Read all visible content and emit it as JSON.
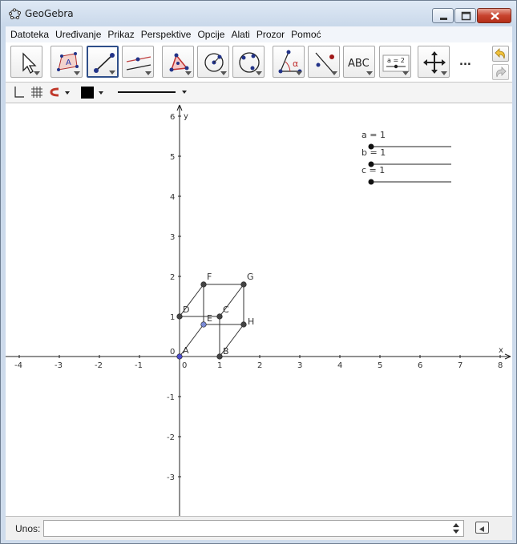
{
  "window": {
    "title": "GeoGebra"
  },
  "menubar": {
    "items": [
      "Datoteka",
      "Uređivanje",
      "Prikaz",
      "Perspektive",
      "Opcije",
      "Alati",
      "Prozor",
      "Pomoć"
    ]
  },
  "toolbar": {
    "tools": [
      "move-tool",
      "polygon-tool",
      "segment-tool",
      "parallel-line-tool",
      "triangle-tool",
      "circle-tool",
      "conic-tool",
      "angle-tool",
      "reflect-tool",
      "text-tool",
      "slider-tool",
      "move-view-tool"
    ],
    "text_tool_label": "ABC",
    "slider_tool_label": "a = 2",
    "more_label": "..."
  },
  "stylebar": {
    "color": "#000000"
  },
  "graphics": {
    "x_axis_label": "x",
    "y_axis_label": "y",
    "x_ticks": [
      "-4",
      "-3",
      "-2",
      "-1",
      "0",
      "1",
      "2",
      "3",
      "4",
      "5",
      "6",
      "7",
      "8"
    ],
    "y_ticks": [
      "6",
      "5",
      "4",
      "3",
      "2",
      "1",
      "0",
      "-1",
      "-2",
      "-3"
    ],
    "sliders": [
      {
        "label": "a = 1",
        "value": 1
      },
      {
        "label": "b = 1",
        "value": 1
      },
      {
        "label": "c = 1",
        "value": 1
      }
    ],
    "points": [
      {
        "name": "A",
        "x": 0,
        "y": 0,
        "color": "#4d4dcc"
      },
      {
        "name": "B",
        "x": 1,
        "y": 0,
        "color": "#444444"
      },
      {
        "name": "C",
        "x": 1,
        "y": 1,
        "color": "#444444"
      },
      {
        "name": "D",
        "x": 0,
        "y": 1,
        "color": "#444444"
      },
      {
        "name": "E",
        "x": 0.6,
        "y": 0.8,
        "color": "#7b8bd6"
      },
      {
        "name": "F",
        "x": 0.6,
        "y": 1.8,
        "color": "#444444"
      },
      {
        "name": "G",
        "x": 1.6,
        "y": 1.8,
        "color": "#444444"
      },
      {
        "name": "H",
        "x": 1.6,
        "y": 0.8,
        "color": "#444444"
      }
    ],
    "edges": [
      [
        "A",
        "B"
      ],
      [
        "B",
        "C"
      ],
      [
        "C",
        "D"
      ],
      [
        "D",
        "A"
      ],
      [
        "E",
        "F"
      ],
      [
        "F",
        "G"
      ],
      [
        "G",
        "H"
      ],
      [
        "H",
        "E"
      ],
      [
        "A",
        "E"
      ],
      [
        "B",
        "H"
      ],
      [
        "C",
        "G"
      ],
      [
        "D",
        "F"
      ]
    ]
  },
  "inputbar": {
    "label": "Unos:",
    "value": ""
  }
}
